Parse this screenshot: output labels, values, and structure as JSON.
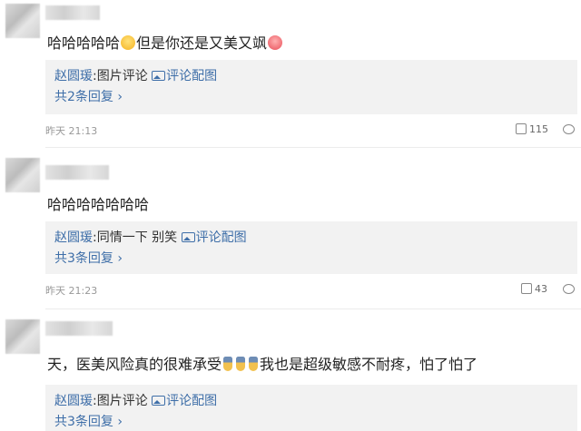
{
  "comments": [
    {
      "text": "哈哈哈哈哈",
      "text_after": "但是你还是又美又飒",
      "reply": {
        "user": "赵圆瑗",
        "text": "图片评论",
        "link": "评论配图"
      },
      "more": "共2条回复",
      "time": "昨天 21:13",
      "likes": "115"
    },
    {
      "text": "哈哈哈哈哈哈哈",
      "reply": {
        "user": "赵圆瑗",
        "text": "同情一下 别笑 ",
        "link": "评论配图"
      },
      "more": "共3条回复",
      "time": "昨天 21:23",
      "likes": "43"
    },
    {
      "text": "天，医美风险真的很难承受",
      "text_after": "我也是超级敏感不耐疼，怕了怕了",
      "reply": {
        "user": "赵圆瑗",
        "text": "图片评论",
        "link": "评论配图"
      },
      "more": "共3条回复"
    }
  ],
  "icons": {
    "like": "thumb-up-icon",
    "comment": "comment-bubble-icon",
    "image": "image-icon"
  },
  "colors": {
    "link": "#3e6ea8",
    "reply_bg": "#f2f2f2",
    "meta": "#999999"
  }
}
